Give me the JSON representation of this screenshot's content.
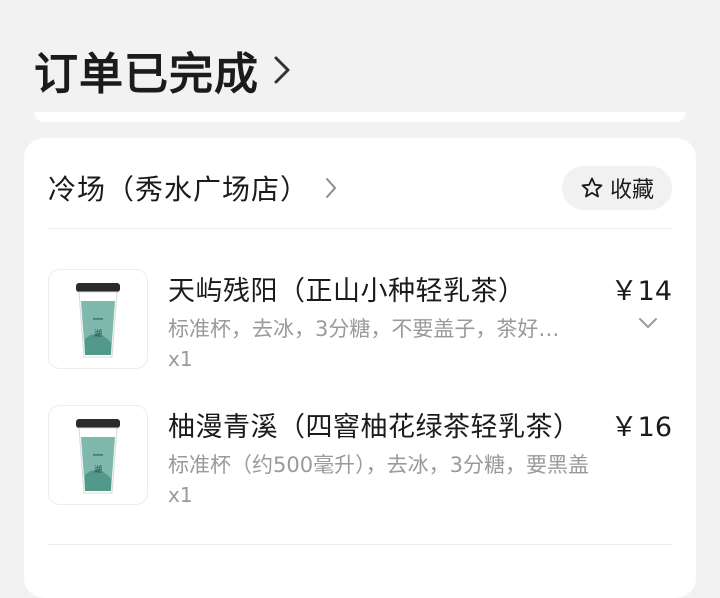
{
  "header": {
    "title": "订单已完成",
    "chevron_icon": "chevron-right-icon"
  },
  "store": {
    "name": "冷场（秀水广场店）",
    "chevron_icon": "chevron-right-icon",
    "favorite_label": "收藏",
    "favorite_icon": "star-outline-icon"
  },
  "items": [
    {
      "name": "天屿残阳（正山小种轻乳茶）",
      "price": "￥14",
      "spec": "标准杯，去冰，3分糖，不要盖子，茶好…",
      "qty": "x1",
      "expand_icon": "chevron-down-icon"
    },
    {
      "name": "柚漫青溪（四窨柚花绿茶轻乳茶）",
      "price": "￥16",
      "spec": "标准杯（约500毫升），去冰，3分糖，要黑盖",
      "qty": "x1"
    }
  ],
  "colors": {
    "background": "#f2f2f2",
    "card": "#ffffff",
    "muted_text": "#9a9a9a",
    "cup_tea": "#7fb8ad"
  }
}
